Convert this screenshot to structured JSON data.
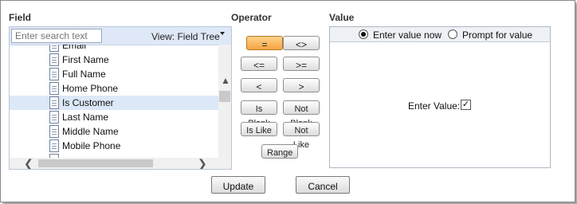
{
  "field": {
    "title": "Field",
    "search_placeholder": "Enter search text",
    "view_label": "View: Field Tree",
    "items": [
      {
        "label": "Email"
      },
      {
        "label": "First Name"
      },
      {
        "label": "Full Name"
      },
      {
        "label": "Home Phone"
      },
      {
        "label": "Is Customer",
        "selected": true
      },
      {
        "label": "Last Name"
      },
      {
        "label": "Middle Name"
      },
      {
        "label": "Mobile Phone"
      }
    ]
  },
  "operator": {
    "title": "Operator",
    "buttons": [
      {
        "label": "=",
        "active": true
      },
      {
        "label": "<>"
      },
      {
        "label": "<="
      },
      {
        "label": ">="
      },
      {
        "label": "<"
      },
      {
        "label": ">"
      },
      {
        "label": "Is Blank"
      },
      {
        "label": "Not Blank"
      },
      {
        "label": "Is Like"
      },
      {
        "label": "Not Like"
      },
      {
        "label": "Range"
      }
    ]
  },
  "value": {
    "title": "Value",
    "radio_enter_now": "Enter value now",
    "radio_prompt": "Prompt for value",
    "enter_value_label": "Enter Value:",
    "checkbox_mark": "✓"
  },
  "actions": {
    "update_label": "Update",
    "cancel_label": "Cancel"
  },
  "icons": {
    "scroll_up": "▲",
    "scroll_down": "▼",
    "scroll_left": "❮",
    "scroll_right": "❯"
  }
}
